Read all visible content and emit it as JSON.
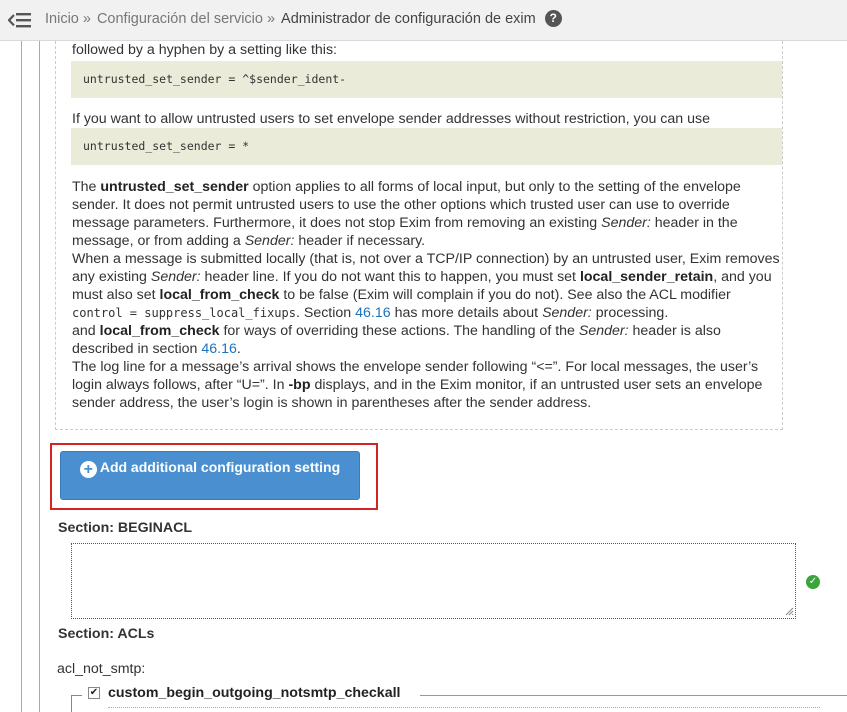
{
  "breadcrumb": {
    "home": "Inicio",
    "service_config": "Configuración del servicio",
    "current": "Administrador de configuración de exim",
    "separator": "»",
    "help_icon": "?"
  },
  "doc": {
    "line_top": "followed by a hyphen by a setting like this:",
    "code1": "untrusted_set_sender = ^$sender_ident-",
    "line_mid": "If you want to allow untrusted users to set envelope sender addresses without restriction, you can use",
    "code2": "untrusted_set_sender = *",
    "p1_a": "The ",
    "p1_b": "untrusted_set_sender",
    "p1_c": " option applies to all forms of local input, but only to the setting of the envelope sender. It does not permit untrusted users to use the other options which trusted user can use to override message parameters. Furthermore, it does not stop Exim from removing an existing ",
    "p1_d": "Sender:",
    "p1_e": " header in the message, or from adding a ",
    "p1_f": "Sender:",
    "p1_g": " header if necessary.",
    "p2_a": "When a message is submitted locally (that is, not over a TCP/IP connection) by an untrusted user, Exim removes any existing ",
    "p2_b": "Sender:",
    "p2_c": " header line. If you do not want this to happen, you must set ",
    "p2_d": "local_sender_retain",
    "p2_e": ", and you must also set ",
    "p2_f": "local_from_check",
    "p2_g": " to be false (Exim will complain if you do not). See also the ACL modifier ",
    "p2_h": "control = suppress_local_fixups",
    "p2_i": ". Section ",
    "p2_j": "46.16",
    "p2_k": " has more details about ",
    "p2_l": "Sender:",
    "p2_m": " processing.",
    "p3_a": "and ",
    "p3_b": "local_from_check",
    "p3_c": " for ways of overriding these actions. The handling of the ",
    "p3_d": "Sender:",
    "p3_e": " header is also described in section ",
    "p3_f": "46.16",
    "p3_g": ".",
    "p4_a": "The log line for a message’s arrival shows the envelope sender following “<=”. For local messages, the user’s login always follows, after “U=”. In ",
    "p4_b": "-bp",
    "p4_c": " displays, and in the Exim monitor, if an untrusted user sets an envelope sender address, the user’s login is shown in parentheses after the sender address."
  },
  "add_button": {
    "icon": "plus-circle-icon",
    "label": "Add additional configuration setting"
  },
  "sections": {
    "beginacl_title": "Section: BEGINACL",
    "beginacl_value": "",
    "acls_title": "Section: ACLs"
  },
  "acl": {
    "label": "acl_not_smtp:",
    "item": "custom_begin_outgoing_notsmtp_checkall",
    "item_checked": true
  },
  "colors": {
    "accent": "#4a90d0",
    "highlight": "#d32424",
    "success": "#3aa53a",
    "code_bg": "#ebebd9",
    "link": "#1c73bd"
  }
}
